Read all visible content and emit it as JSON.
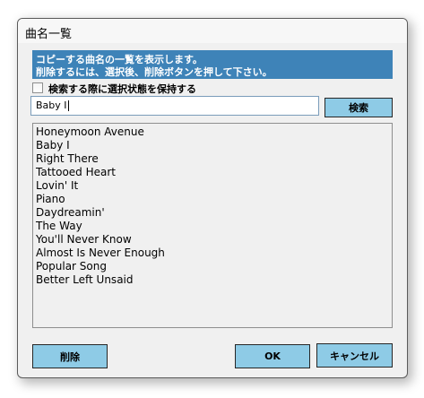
{
  "window": {
    "title": "曲名一覧"
  },
  "banner": {
    "line1": "コピーする曲名の一覧を表示します。",
    "line2": "削除するには、選択後、削除ボタンを押して下さい。"
  },
  "options": {
    "keep_selection_label": "検索する際に選択状態を保持する",
    "keep_selection_checked": false
  },
  "search": {
    "value": "Baby I",
    "button_label": "検索"
  },
  "songs": [
    "Honeymoon Avenue",
    "Baby I",
    "Right There",
    "Tattooed Heart",
    "Lovin' It",
    "Piano",
    "Daydreamin'",
    "The Way",
    "You'll Never Know",
    "Almost Is Never Enough",
    "Popular Song",
    "Better Left Unsaid"
  ],
  "buttons": {
    "delete_label": "削除",
    "ok_label": "OK",
    "cancel_label": "キャンセル"
  },
  "colors": {
    "banner": "#3e83b8",
    "button": "#8ecbe6"
  }
}
